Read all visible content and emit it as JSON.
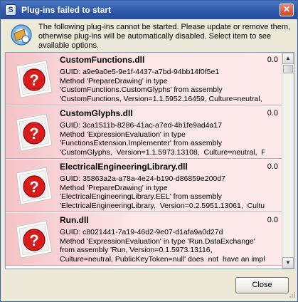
{
  "window": {
    "title": "Plug-ins failed to start",
    "title_close_glyph": "✕"
  },
  "header": {
    "message": "The following plug-ins cannot be started. Please update or remove them, otherwise plug-ins will be automatically disabled. Select item to see available options.",
    "icon": "plugin-warning-icon"
  },
  "plugins": [
    {
      "name": "CustomFunctions.dll",
      "version": "0.0",
      "details": "GUID: a9e9a0e5-9e1f-4437-a7bd-94bb14f0f5e1\nMethod 'PrepareDrawing' in type\n'CustomFunctions.CustomGlyphs' from assembly\n'CustomFunctions, Version=1.1.5952.16459, Culture=neutral,"
    },
    {
      "name": "CustomGlyphs.dll",
      "version": "0.0",
      "details": "GUID: 3ca1511b-8286-41ac-a7ed-4b1fe9ad4a17\nMethod 'ExpressionEvaluation' in type\n'FunctionsExtension.Implementer' from assembly\n'CustomGlyphs,  Version=1.1.5973.13108,  Culture=neutral,  Pu"
    },
    {
      "name": "ElectricalEngineeringLibrary.dll",
      "version": "0.0",
      "details": "GUID: 35863a2a-a78a-4e24-b190-d86859e200d7\nMethod 'PrepareDrawing' in type\n'ElectricalEngineeringLibrary.EEL' from assembly\n'ElectricalEngineeringLibrary,  Version=0.2.5951.13061,  Cultur"
    },
    {
      "name": "Run.dll",
      "version": "0.0",
      "details": "GUID: c8021441-7a19-46d2-9e07-d1afa9a0d27d\nMethod 'ExpressionEvaluation' in type 'Run.DataExchange'\nfrom assembly 'Run, Version=0.1.5973.13116,\nCulture=neutral, PublicKeyToken=null' does  not  have an impl"
    }
  ],
  "icons": {
    "plugin": "plugin-question-icon",
    "remove": "stop-icon"
  },
  "buttons": {
    "close": "Close"
  },
  "colors": {
    "titlebar": "#2d57a8",
    "item_background": "#f7cfd2",
    "stop": "#c40000"
  }
}
